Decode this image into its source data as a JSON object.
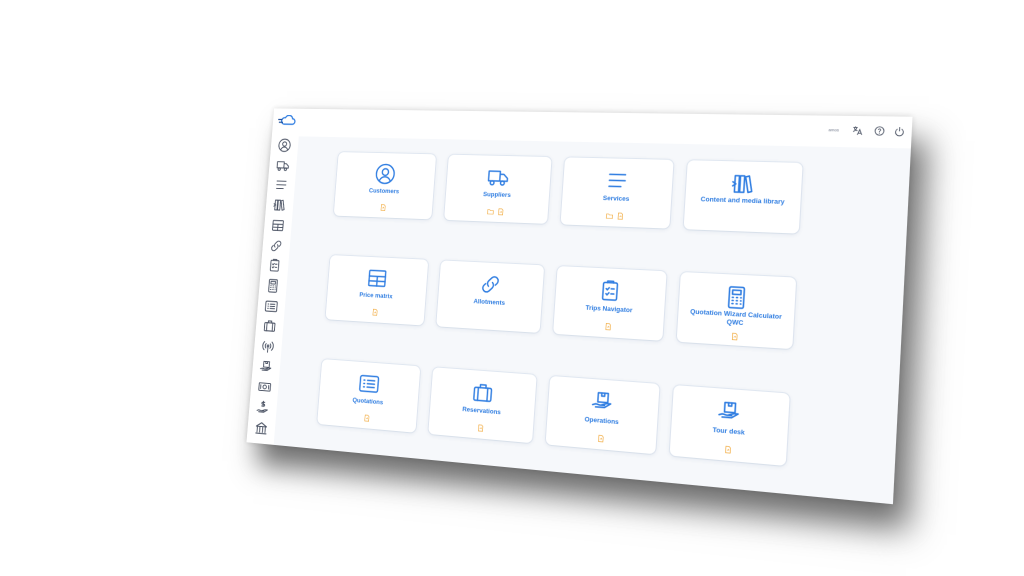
{
  "colors": {
    "accent": "#2f7de1",
    "badge": "#f0a22b",
    "icon_gray": "#4a5263"
  },
  "app": {
    "logo": "cloud-logo"
  },
  "sidebar": {
    "items": [
      {
        "icon": "user-circle-icon"
      },
      {
        "icon": "truck-icon"
      },
      {
        "icon": "lines-icon"
      },
      {
        "icon": "books-icon"
      },
      {
        "icon": "table-icon"
      },
      {
        "icon": "link-icon"
      },
      {
        "icon": "clipboard-icon"
      },
      {
        "icon": "calculator-icon"
      },
      {
        "icon": "list-icon"
      },
      {
        "icon": "suitcase-icon"
      },
      {
        "icon": "broadcast-icon"
      },
      {
        "icon": "box-hand-icon"
      },
      {
        "icon": "money-icon"
      },
      {
        "icon": "dollar-hand-icon"
      },
      {
        "icon": "bank-icon"
      }
    ]
  },
  "topbar": {
    "user_label": "amos",
    "icons": [
      "translate-icon",
      "help-icon",
      "power-icon"
    ]
  },
  "modules": [
    {
      "label": "Customers",
      "icon": "user-circle-icon",
      "badges": [
        "file-icon"
      ]
    },
    {
      "label": "Suppliers",
      "icon": "truck-icon",
      "badges": [
        "folder-icon",
        "file-icon"
      ]
    },
    {
      "label": "Services",
      "icon": "lines-icon",
      "badges": [
        "folder-icon",
        "file-icon"
      ]
    },
    {
      "label": "Content and media library",
      "icon": "books-icon",
      "badges": []
    },
    {
      "label": "Price matrix",
      "icon": "table-icon",
      "badges": [
        "file-icon"
      ]
    },
    {
      "label": "Allotments",
      "icon": "link-icon",
      "badges": []
    },
    {
      "label": "Trips Navigator",
      "icon": "clipboard-icon",
      "badges": [
        "file-icon"
      ]
    },
    {
      "label": "Quotation Wizard Calculator QWC",
      "icon": "calculator-icon",
      "badges": [
        "file-icon"
      ]
    },
    {
      "label": "Quotations",
      "icon": "list-icon",
      "badges": [
        "file-icon"
      ]
    },
    {
      "label": "Reservations",
      "icon": "suitcase-icon",
      "badges": [
        "file-icon"
      ]
    },
    {
      "label": "Operations",
      "icon": "box-hand-icon",
      "badges": [
        "file-icon"
      ]
    },
    {
      "label": "Tour desk",
      "icon": "box-hand-icon",
      "badges": [
        "file-icon"
      ]
    }
  ]
}
